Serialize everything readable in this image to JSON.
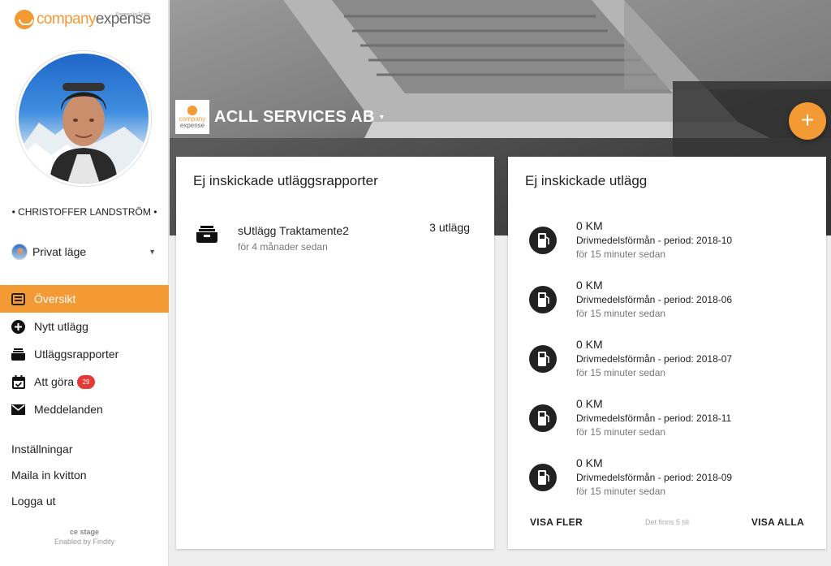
{
  "brand": {
    "logo_part1": "company",
    "logo_part2": "expense",
    "logo_sub": "Powered by Findity",
    "accent_color": "#f39a35"
  },
  "user": {
    "name": "• CHRISTOFFER LANDSTRÖM •",
    "mode_label": "Privat läge"
  },
  "nav": {
    "items": [
      {
        "label": "Översikt",
        "icon": "overview-icon",
        "active": true
      },
      {
        "label": "Nytt utlägg",
        "icon": "add-circle-icon"
      },
      {
        "label": "Utläggsrapporter",
        "icon": "report-tray-icon"
      },
      {
        "label": "Att göra",
        "icon": "calendar-check-icon",
        "badge": "29"
      },
      {
        "label": "Meddelanden",
        "icon": "mail-icon"
      }
    ]
  },
  "links": {
    "settings": "Inställningar",
    "mail_receipts": "Maila in kvitton",
    "logout": "Logga ut"
  },
  "footer": {
    "stage": "ce stage",
    "enabled_by": "Enabled by Findity"
  },
  "company": {
    "name": "ACLL SERVICES AB",
    "logo_line1": "company",
    "logo_line2": "expense",
    "caret": "▾"
  },
  "fab": {
    "label": "+"
  },
  "reports_card": {
    "title": "Ej inskickade utläggsrapporter",
    "items": [
      {
        "name": "sUtlägg Traktamente2",
        "time": "för 4 månader sedan",
        "count": "3 utlägg"
      }
    ]
  },
  "expenses_card": {
    "title": "Ej inskickade utlägg",
    "items": [
      {
        "amount": "0 KM",
        "desc": "Drivmedelsförmån - period: 2018-10",
        "time": "för 15 minuter sedan"
      },
      {
        "amount": "0 KM",
        "desc": "Drivmedelsförmån - period: 2018-06",
        "time": "för 15 minuter sedan"
      },
      {
        "amount": "0 KM",
        "desc": "Drivmedelsförmån - period: 2018-07",
        "time": "för 15 minuter sedan"
      },
      {
        "amount": "0 KM",
        "desc": "Drivmedelsförmån - period: 2018-11",
        "time": "för 15 minuter sedan"
      },
      {
        "amount": "0 KM",
        "desc": "Drivmedelsförmån - period: 2018-09",
        "time": "för 15 minuter sedan"
      }
    ],
    "visa_fler": "VISA FLER",
    "det_finns": "Det finns 5 till",
    "visa_alla": "VISA ALLA"
  }
}
